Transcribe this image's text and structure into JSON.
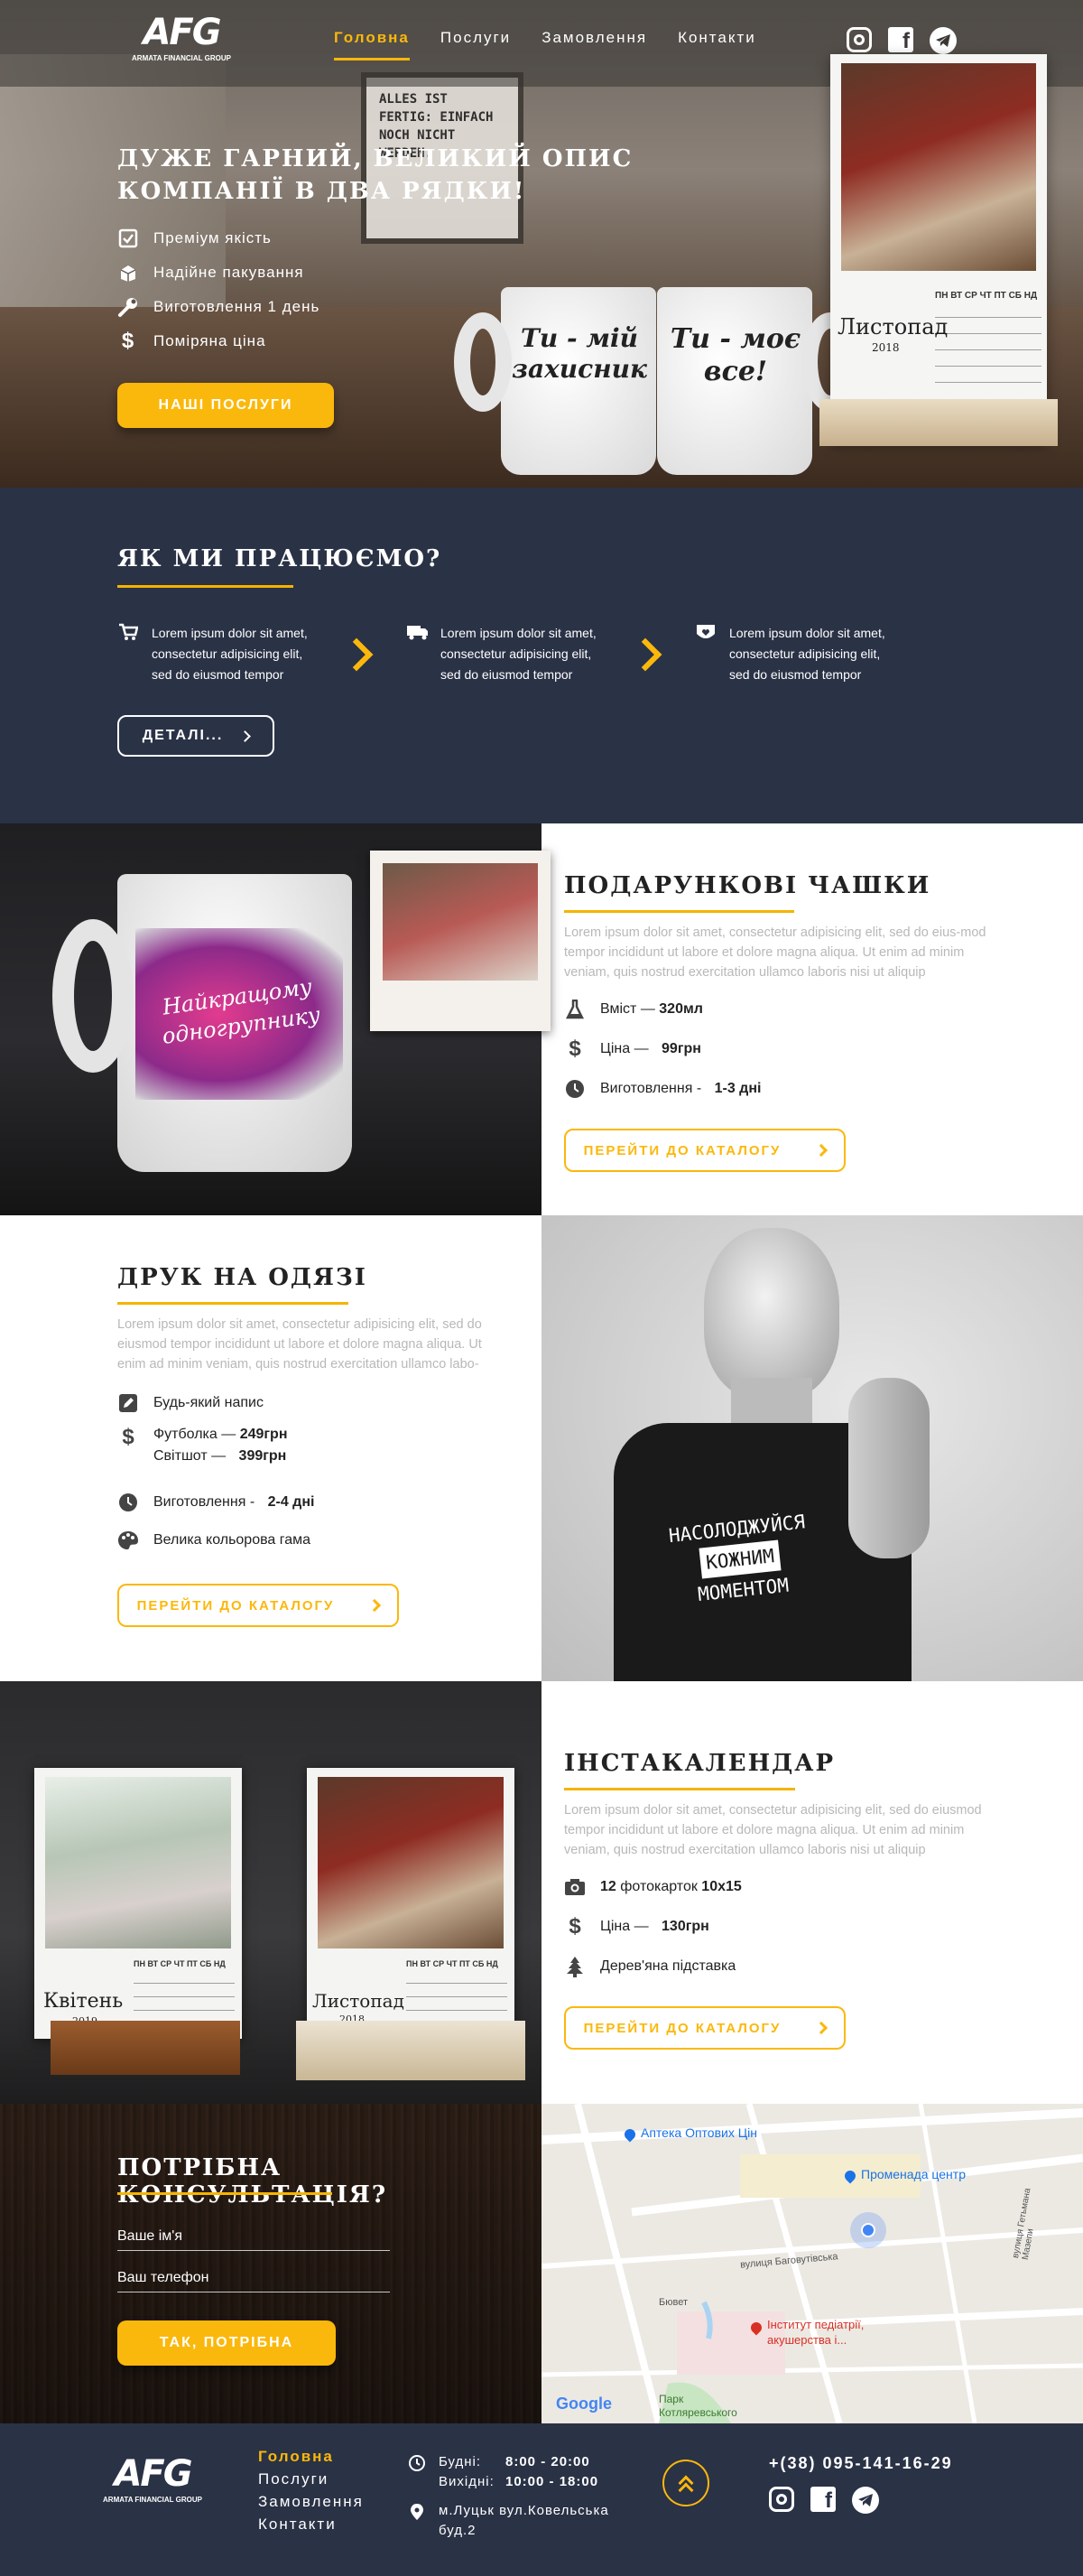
{
  "brand": {
    "logo_text": "AFG",
    "logo_sub": "ARMATA FINANCIAL GROUP"
  },
  "nav": {
    "items": [
      {
        "label": "Головна",
        "active": true
      },
      {
        "label": "Послуги"
      },
      {
        "label": "Замовлення"
      },
      {
        "label": "Контакти"
      }
    ]
  },
  "social": [
    "instagram-icon",
    "facebook-icon",
    "telegram-icon"
  ],
  "hero": {
    "title_line1": "ДУЖЕ ГАРНИЙ, ВЕЛИКИЙ ОПИС",
    "title_line2": "КОМПАНІЇ В ДВА РЯДКИ!",
    "features": [
      "Преміум якість",
      "Надійне пакування",
      "Виготовлення 1 день",
      "Поміряна ціна"
    ],
    "cta": "НАШІ ПОСЛУГИ",
    "mug1_text": "Ти - мій захисник",
    "mug2_text": "Ти - моє все!",
    "board_text": "ALLES IST FERTIG: EINFACH NOCH NICHT WERDEN.",
    "cal_month": "Листопад",
    "cal_year": "2018",
    "cal_days": "ПН ВТ СР ЧТ ПТ СБ НД"
  },
  "how": {
    "title": "ЯК МИ ПРАЦЮЄМО?",
    "steps": [
      {
        "l1": "Lorem ipsum dolor sit amet,",
        "l2": "consectetur adipisicing elit,",
        "l3": "sed do eiusmod tempor"
      },
      {
        "l1": "Lorem ipsum dolor sit amet,",
        "l2": "consectetur adipisicing elit,",
        "l3": "sed do eiusmod tempor"
      },
      {
        "l1": "Lorem ipsum dolor sit amet,",
        "l2": "consectetur adipisicing elit,",
        "l3": "sed do eiusmod tempor"
      }
    ],
    "details": "ДЕТАЛІ..."
  },
  "mugs": {
    "title": "ПОДАРУНКОВІ ЧАШКИ",
    "text": "Lorem ipsum dolor sit amet, consectetur adipisicing elit, sed do eius-mod tempor incididunt ut labore et dolore magna aliqua. Ut enim ad minim veniam, quis nostrud exercitation ullamco laboris nisi ut aliquip",
    "f1_label": "Вміст — ",
    "f1_val": "320мл",
    "f2_label": "Ціна — ",
    "f2_val": "99грн",
    "f3_label": "Виготовлення - ",
    "f3_val": "1-3 дні",
    "cta": "ПЕРЕЙТИ ДО КАТАЛОГУ",
    "mug_text": "Найкращому одногрупнику"
  },
  "print": {
    "title": "ДРУК НА ОДЯЗІ",
    "text": "Lorem ipsum dolor sit amet, consectetur adipisicing elit, sed do eiusmod tempor incididunt ut labore et dolore magna aliqua. Ut enim ad minim veniam, quis nostrud exercitation ullamco labo-",
    "f1": "Будь-який напис",
    "f2_label": "Футболка — ",
    "f2_val": "249грн",
    "f2b_label": "Світшот — ",
    "f2b_val": "399грн",
    "f3_label": "Виготовлення - ",
    "f3_val": "2-4 дні",
    "f4": "Велика кольорова гама",
    "cta": "ПЕРЕЙТИ ДО КАТАЛОГУ",
    "shirt_l1": "НАСОЛОДЖУЙСЯ",
    "shirt_l2": "КОЖНИМ",
    "shirt_l3": "МОМЕНТОМ"
  },
  "insta": {
    "title": "ІНСТАКАЛЕНДАР",
    "text": "Lorem ipsum dolor sit amet, consectetur adipisicing elit, sed do eiusmod tempor incididunt ut labore et dolore magna aliqua. Ut enim ad minim veniam, quis nostrud exercitation ullamco laboris nisi ut aliquip",
    "f1_val": "12",
    "f1_label": " фотокарток ",
    "f1_val2": "10х15",
    "f2_label": "Ціна — ",
    "f2_val": "130грн",
    "f3": "Дерев'яна підставка",
    "cta": "ПЕРЕЙТИ ДО КАТАЛОГУ",
    "cal1_month": "Квітень",
    "cal1_year": "2019",
    "cal2_month": "Листопад",
    "cal2_year": "2018",
    "cal_days": "ПН ВТ СР ЧТ ПТ СБ НД"
  },
  "consult": {
    "title": "ПОТРІБНА КОНСУЛЬТАЦІЯ?",
    "name_placeholder": "Ваше ім'я",
    "phone_placeholder": "Ваш телефон",
    "cta": "ТАК, ПОТРІБНА"
  },
  "map": {
    "labels": [
      "Аптека Оптових Цін",
      "Променада центр",
      "вулиця Баговутівська",
      "Інститут педіатрії, акушерства і...",
      "Парк Котляревського",
      "Google",
      "вулиця Гетьмана Мазепи",
      "Бювет"
    ]
  },
  "footer": {
    "links": [
      "Головна",
      "Послуги",
      "Замовлення",
      "Контакти"
    ],
    "hours1_label": "Будні:",
    "hours1_val": "8:00 - 20:00",
    "hours2_label": "Вихідні:",
    "hours2_val": "10:00 - 18:00",
    "address_l1": "м.Луцьк вул.Ковельська",
    "address_l2": "буд.2",
    "phone": "+(38) 095-141-16-29"
  },
  "colors": {
    "accent": "#fbb80c",
    "dark": "#2a3246"
  }
}
